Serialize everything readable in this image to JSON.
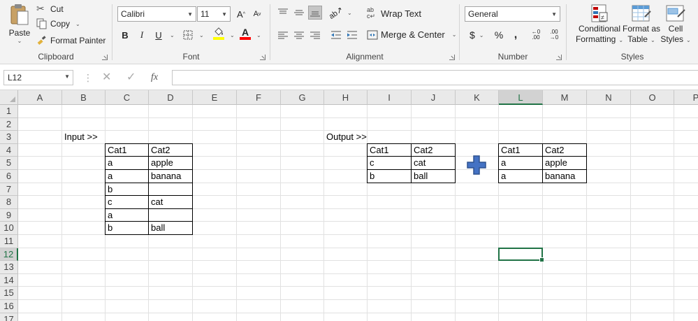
{
  "ribbon": {
    "clipboard": {
      "paste": "Paste",
      "cut": "Cut",
      "copy": "Copy",
      "format_painter": "Format Painter",
      "label": "Clipboard"
    },
    "font": {
      "name": "Calibri",
      "size": "11",
      "label": "Font",
      "bold": "B",
      "italic": "I",
      "underline": "U",
      "grow": "A",
      "shrink": "A",
      "font_color": "A"
    },
    "alignment": {
      "wrap_text": "Wrap Text",
      "merge_center": "Merge & Center",
      "label": "Alignment"
    },
    "number": {
      "format": "General",
      "currency": "$",
      "percent": "%",
      "comma": ",",
      "inc_decimal": "←0 .00",
      "dec_decimal": ".00 →0",
      "label": "Number"
    },
    "styles": {
      "conditional_1": "Conditional",
      "conditional_2": "Formatting",
      "table_1": "Format as",
      "table_2": "Table",
      "cell_1": "Cell",
      "cell_2": "Styles",
      "label": "Styles"
    },
    "colors": {
      "highlight": "#ffff00",
      "font_color": "#ff0000"
    }
  },
  "formula_bar": {
    "name_box": "L12",
    "fx": "fx",
    "formula": ""
  },
  "sheet": {
    "columns": [
      "A",
      "B",
      "C",
      "D",
      "E",
      "F",
      "G",
      "H",
      "I",
      "J",
      "K",
      "L",
      "M",
      "N",
      "O",
      "P"
    ],
    "rows": [
      "1",
      "2",
      "3",
      "4",
      "5",
      "6",
      "7",
      "8",
      "9",
      "10",
      "11",
      "12",
      "13",
      "14",
      "15",
      "16",
      "17"
    ],
    "selected_col": "L",
    "selected_row": "12",
    "input_label": "Input >>",
    "output_label": "Output >>",
    "input_table": [
      [
        "Cat1",
        "Cat2"
      ],
      [
        "a",
        "apple"
      ],
      [
        "a",
        "banana"
      ],
      [
        "b",
        ""
      ],
      [
        "c",
        "cat"
      ],
      [
        "a",
        ""
      ],
      [
        "b",
        "ball"
      ]
    ],
    "output_table": [
      [
        "Cat1",
        "Cat2"
      ],
      [
        "c",
        "cat"
      ],
      [
        "b",
        "ball"
      ]
    ],
    "output_table2": [
      [
        "Cat1",
        "Cat2"
      ],
      [
        "a",
        "apple"
      ],
      [
        "a",
        "banana"
      ]
    ],
    "accent": "#217346",
    "plus_color": "#4472c4"
  }
}
